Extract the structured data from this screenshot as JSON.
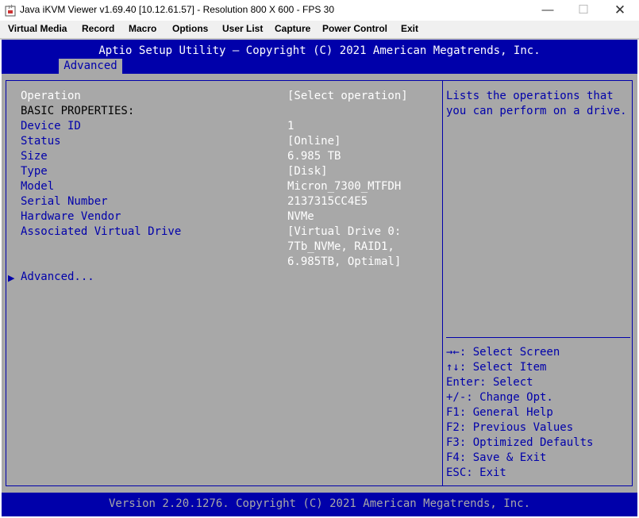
{
  "window": {
    "title": "Java iKVM Viewer v1.69.40 [10.12.61.57]  - Resolution 800 X 600 - FPS 30",
    "minimize_glyph": "—",
    "maximize_glyph": "☐",
    "close_glyph": "✕"
  },
  "menu": [
    "Virtual Media",
    "Record",
    "Macro",
    "Options",
    "User List",
    "Capture",
    "Power Control",
    "Exit"
  ],
  "bios": {
    "title": "Aptio Setup Utility – Copyright (C) 2021 American Megatrends, Inc.",
    "active_tab": "Advanced",
    "rows": [
      {
        "label": "Operation",
        "value": "[Select operation]"
      },
      {
        "label": "BASIC PROPERTIES:",
        "value": ""
      },
      {
        "label": "Device ID",
        "value": "1"
      },
      {
        "label": "Status",
        "value": "[Online]"
      },
      {
        "label": "Size",
        "value": "6.985 TB"
      },
      {
        "label": "Type",
        "value": "[Disk]"
      },
      {
        "label": "Model",
        "value": "Micron_7300_MTFDH"
      },
      {
        "label": "Serial Number",
        "value": "2137315CC4E5"
      },
      {
        "label": "Hardware Vendor",
        "value": "NVMe"
      },
      {
        "label": "Associated Virtual Drive",
        "value": "[Virtual Drive 0:"
      },
      {
        "label": "",
        "value": "7Tb_NVMe, RAID1,"
      },
      {
        "label": "",
        "value": "6.985TB, Optimal]"
      },
      {
        "label": "Advanced...",
        "value": ""
      }
    ],
    "help_text": [
      "Lists the operations that",
      "you can perform on a drive."
    ],
    "key_help": [
      "→←: Select Screen",
      "↑↓: Select Item",
      "Enter: Select",
      "+/-: Change Opt.",
      "F1: General Help",
      "F2: Previous Values",
      "F3: Optimized Defaults",
      "F4: Save & Exit",
      "ESC: Exit"
    ],
    "footer": "Version 2.20.1276. Copyright (C) 2021 American Megatrends, Inc.",
    "submenu_arrow": "▶"
  },
  "colors": {
    "bios_blue": "#0000aa",
    "bios_gray": "#a8a8a8",
    "bios_white": "#ffffff"
  }
}
